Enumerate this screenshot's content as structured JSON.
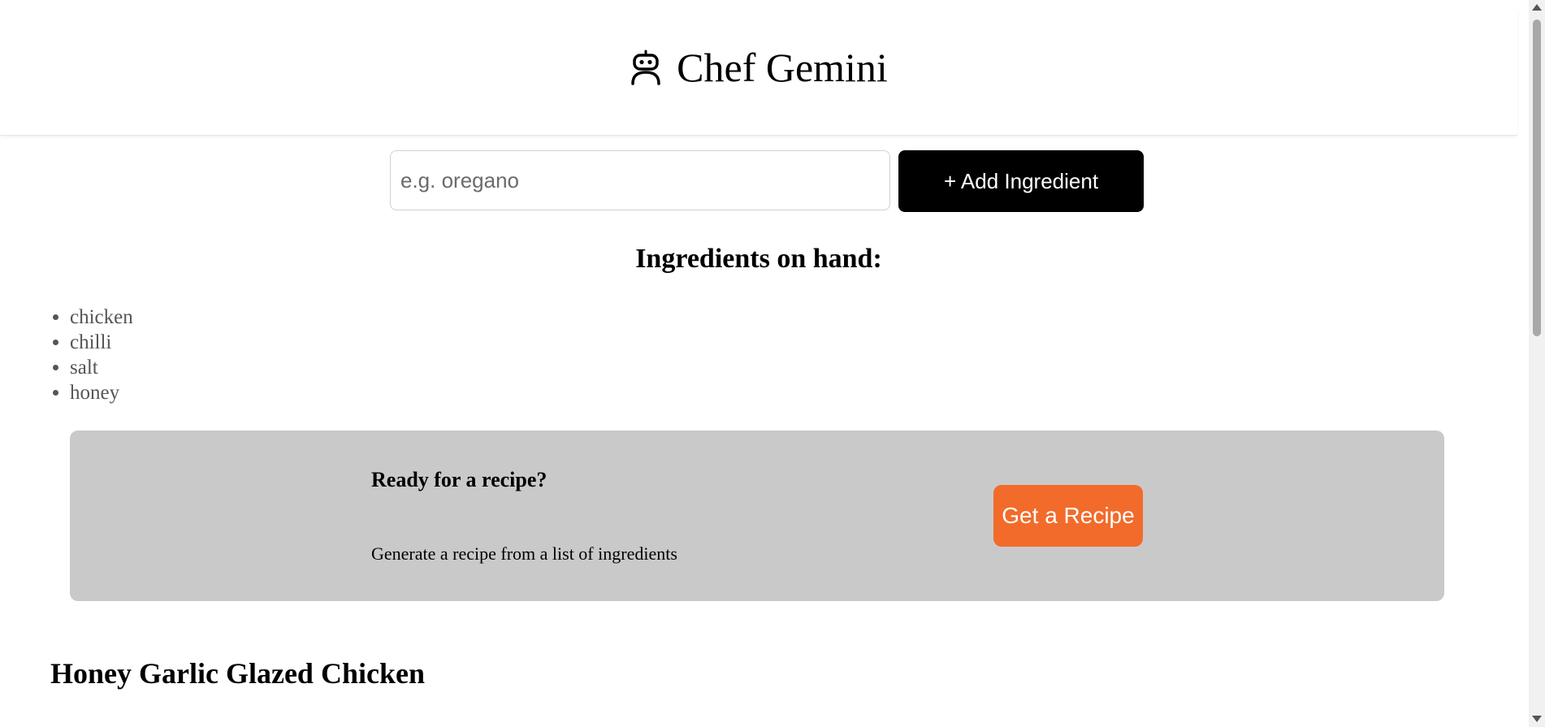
{
  "app": {
    "title": "Chef Gemini",
    "logo_icon": "robot-icon"
  },
  "add_form": {
    "placeholder": "e.g. oregano",
    "value": "",
    "button_label": "+ Add Ingredient"
  },
  "ingredients": {
    "heading": "Ingredients on hand:",
    "items": [
      "chicken",
      "chilli",
      "salt",
      "honey"
    ]
  },
  "cta": {
    "title": "Ready for a recipe?",
    "description": "Generate a recipe from a list of ingredients",
    "button_label": "Get a Recipe",
    "button_color": "#f26b2a",
    "panel_color": "#cac9ca"
  },
  "recipe": {
    "title": "Honey Garlic Glazed Chicken"
  }
}
